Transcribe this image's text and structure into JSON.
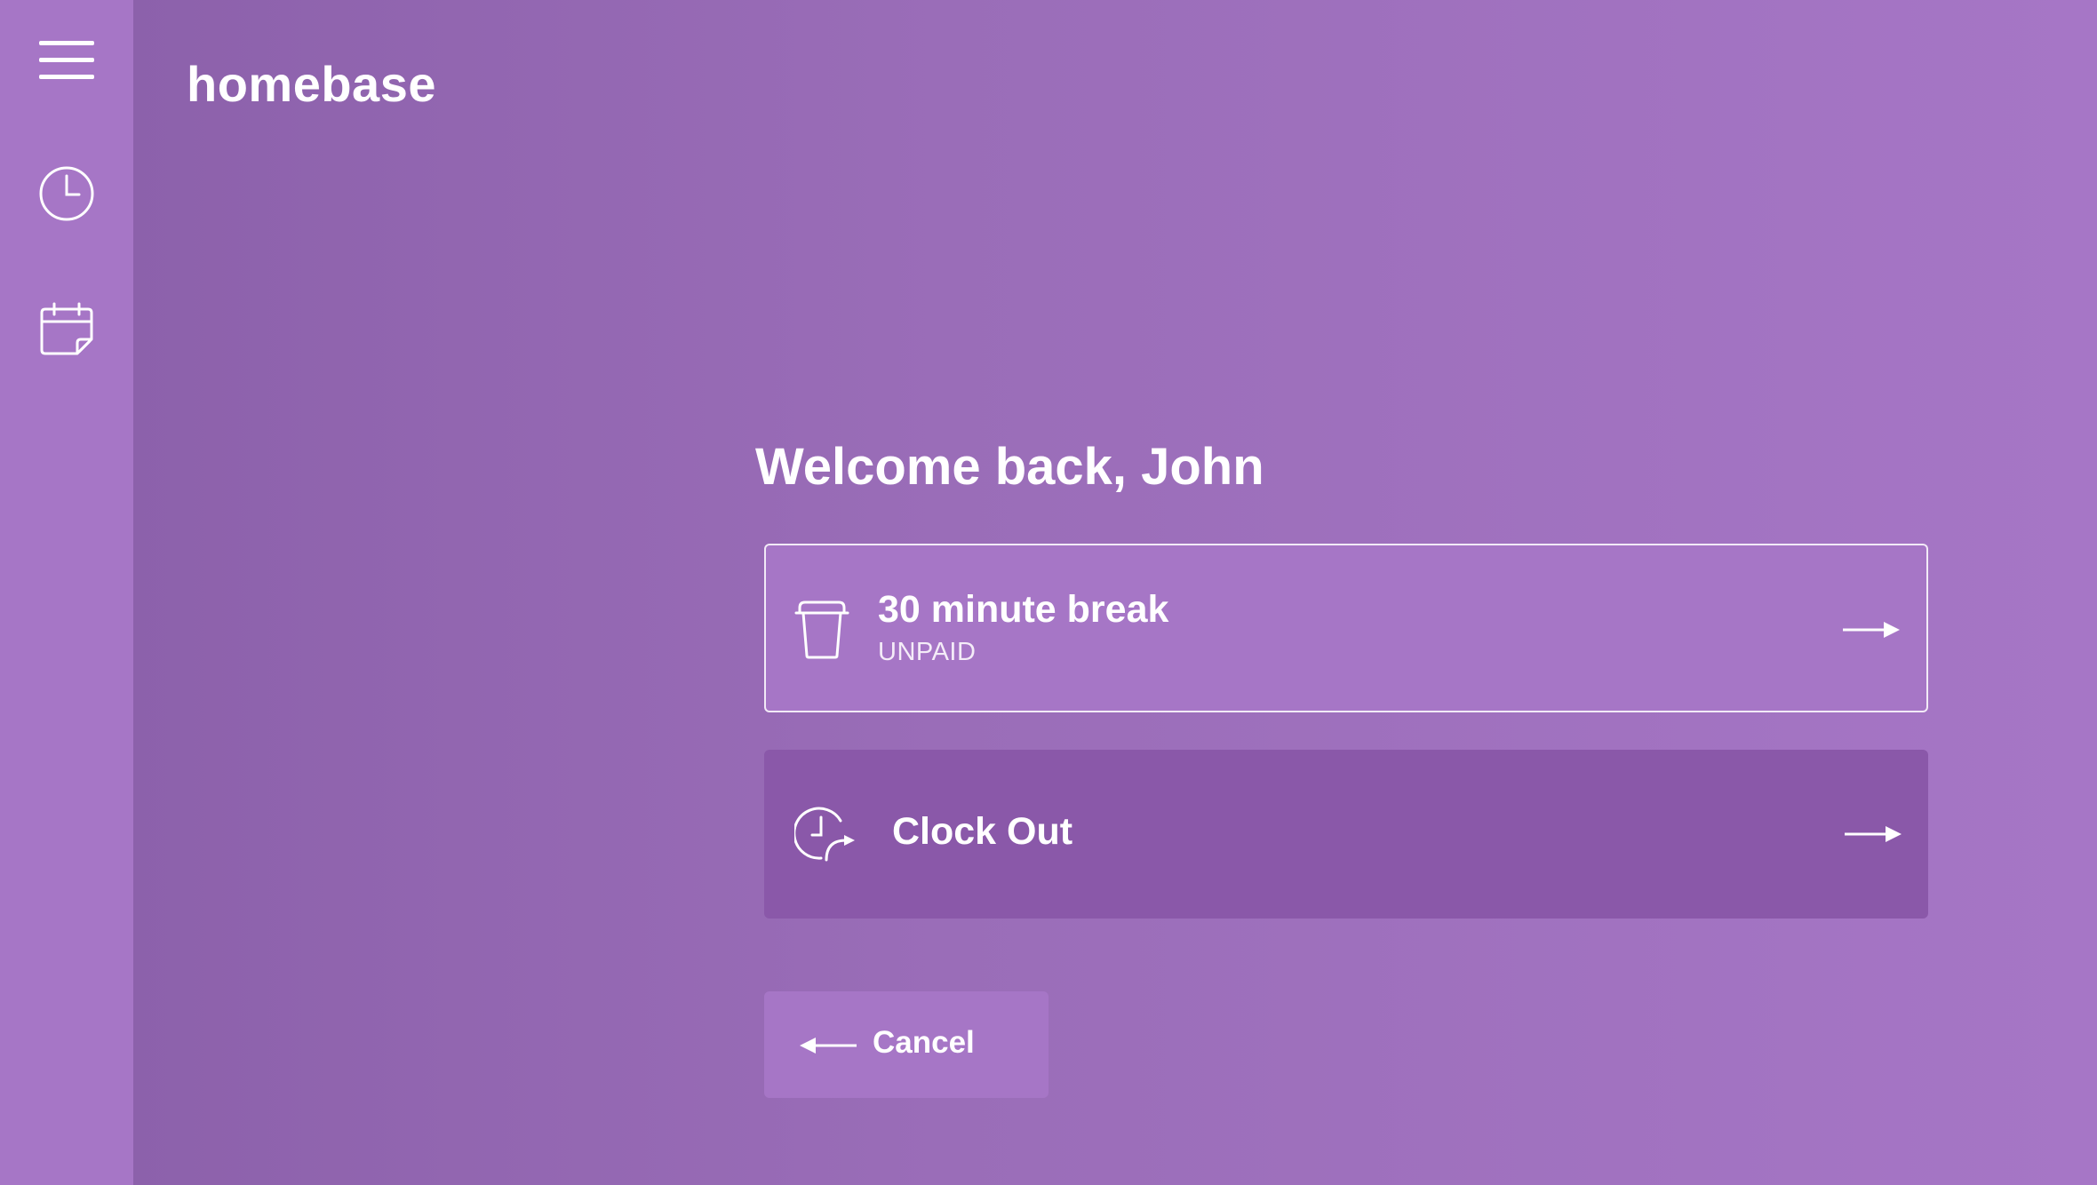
{
  "app": {
    "logo": "homebase"
  },
  "sidebar": {
    "items": [
      {
        "icon": "hamburger-menu-icon"
      },
      {
        "icon": "clock-icon"
      },
      {
        "icon": "calendar-icon"
      }
    ]
  },
  "main": {
    "welcome": "Welcome back, John",
    "options": [
      {
        "title": "30 minute break",
        "subtitle": "UNPAID",
        "icon": "coffee-cup-icon",
        "arrow": "arrow-right-icon"
      },
      {
        "title": "Clock Out",
        "icon": "clock-out-icon",
        "arrow": "arrow-right-icon"
      }
    ],
    "cancel_label": "Cancel"
  },
  "colors": {
    "sidebar": "#a676c6",
    "background_start": "#8a5fa9",
    "background_end": "#a676c6",
    "break_card": "#a676c6",
    "clockout_card": "#8a58a9",
    "text": "#ffffff"
  }
}
